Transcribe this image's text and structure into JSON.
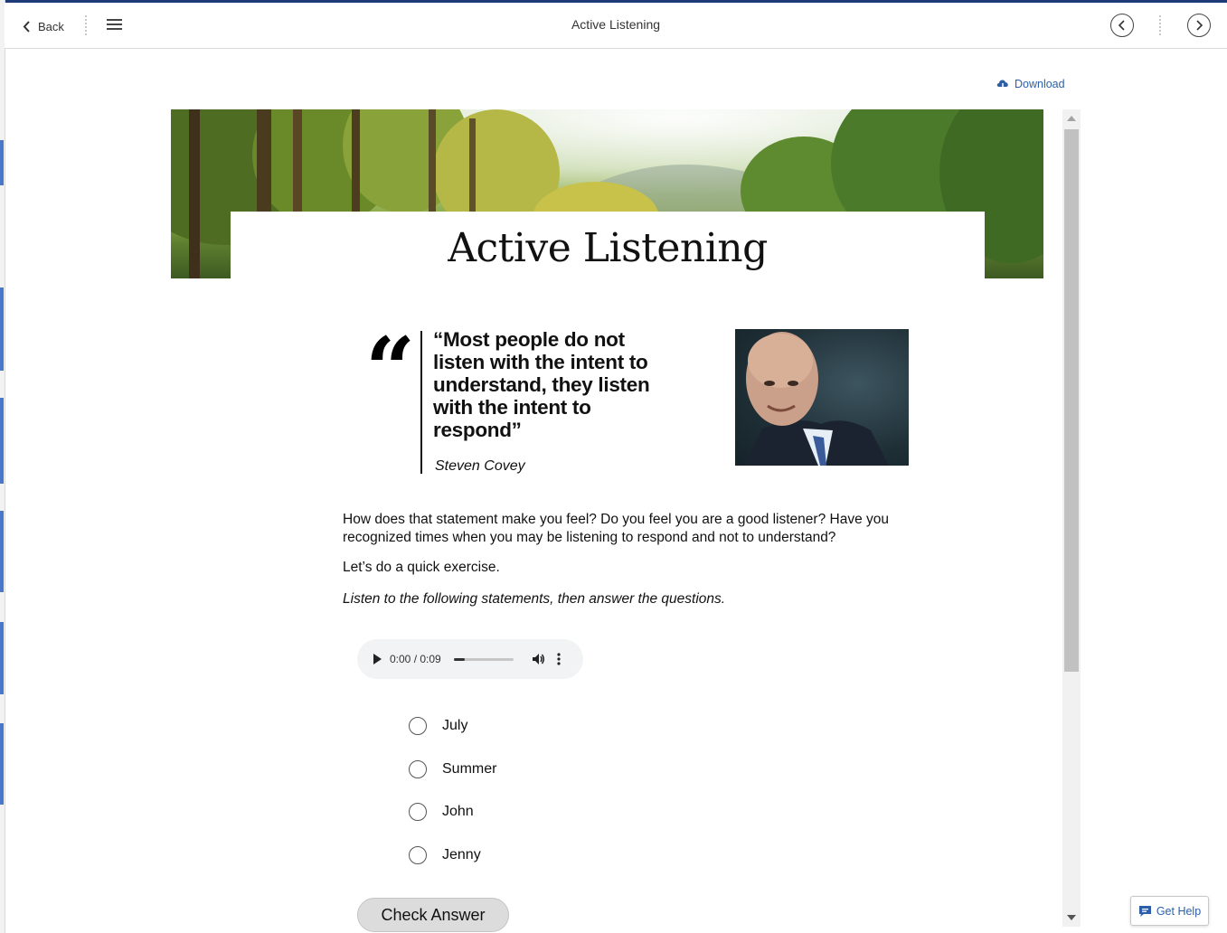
{
  "window": {
    "title": "Active Listening"
  },
  "toolbar": {
    "back_label": "Back",
    "icons": {
      "back": "chevron-left-icon",
      "menu": "hamburger-menu-icon",
      "prev": "chevron-circle-left-icon",
      "next": "chevron-circle-right-icon"
    }
  },
  "download": {
    "label": "Download",
    "icon": "cloud-download-icon"
  },
  "lesson": {
    "title": "Active Listening",
    "quote": {
      "text": "“Most people do not listen with the intent to understand, they listen with the intent to respond”",
      "author": "Steven Covey"
    },
    "paragraph1": "How does that statement make you feel? Do you feel you are a good listener? Have you recognized times when you may be listening to respond and not to understand?",
    "paragraph2": "Let’s do a quick exercise.",
    "instruction": "Listen to the following statements, then answer the questions.",
    "audio": {
      "time": "0:00 / 0:09",
      "progress": 0.18
    },
    "options": [
      "July",
      "Summer",
      "John",
      "Jenny"
    ],
    "check_answer_label": "Check Answer"
  },
  "help": {
    "label": "Get Help",
    "icon": "chat-icon"
  },
  "colors": {
    "link": "#2d5fa8",
    "accent_bar": "#1f3a78"
  }
}
